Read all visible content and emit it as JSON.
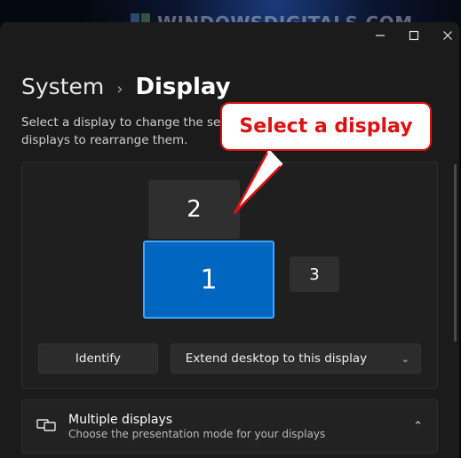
{
  "watermark": "WINDOWSDIGITALS.COM",
  "breadcrumb": {
    "parent": "System",
    "current": "Display"
  },
  "subtext": "Select a display to change the settings for it. Drag displays to rearrange them.",
  "displays": {
    "d1": "1",
    "d2": "2",
    "d3": "3"
  },
  "buttons": {
    "identify": "Identify",
    "extend": "Extend desktop to this display"
  },
  "section": {
    "title": "Multiple displays",
    "desc": "Choose the presentation mode for your displays"
  },
  "callout": "Select a display"
}
